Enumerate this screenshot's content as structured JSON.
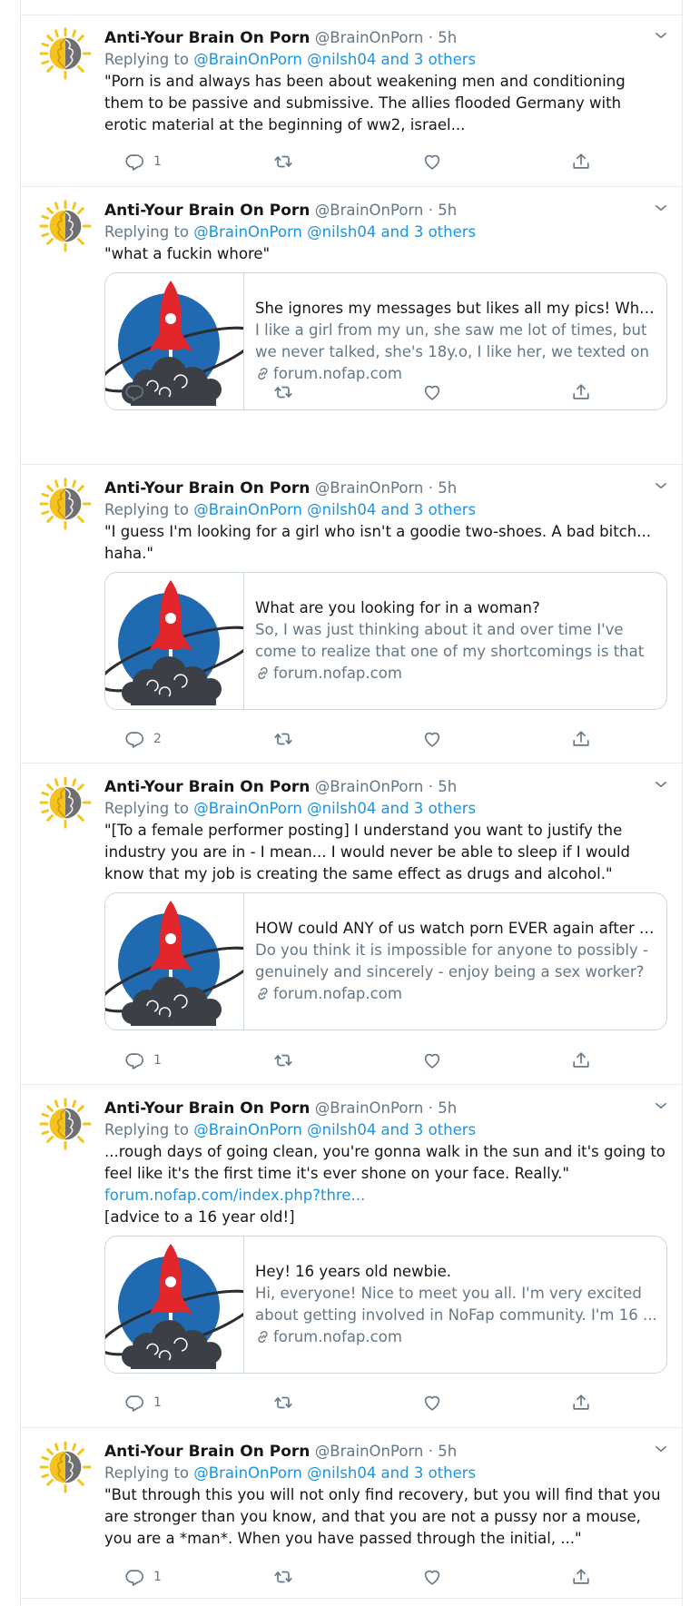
{
  "tweets": [
    {
      "name": "Anti-Your Brain On Porn",
      "handle": "@BrainOnPorn",
      "time": "· 5h",
      "replying_prefix": "Replying to ",
      "replying_to": "@BrainOnPorn @nilsh04 and 3 others",
      "text": "\"Porn is and always has been about weakening men and conditioning them to be passive and submissive. The allies flooded Germany with erotic material at the beginning of ww2, israel...",
      "reply_count": "1"
    },
    {
      "name": "Anti-Your Brain On Porn",
      "handle": "@BrainOnPorn",
      "time": "· 5h",
      "replying_prefix": "Replying to ",
      "replying_to": "@BrainOnPorn @nilsh04 and 3 others",
      "text": "\"what a fuckin whore\"",
      "card": {
        "title": "She ignores my messages but likes all my pics! What ...",
        "description": "I like a girl from my un, she saw me lot of times, but we never talked, she's 18y.o, I like her, we texted on ...",
        "domain": "forum.nofap.com"
      },
      "reply_count": ""
    },
    {
      "name": "Anti-Your Brain On Porn",
      "handle": "@BrainOnPorn",
      "time": "· 5h",
      "replying_prefix": "Replying to ",
      "replying_to": "@BrainOnPorn @nilsh04 and 3 others",
      "text": "\"I guess I'm looking for a girl who isn't a goodie two-shoes. A bad bitch... haha.\"",
      "card": {
        "title": "What are you looking for in a woman?",
        "description": "So, I was just thinking about it and over time I've come to realize that one of my shortcomings is that my vie...",
        "domain": "forum.nofap.com"
      },
      "reply_count": "2"
    },
    {
      "name": "Anti-Your Brain On Porn",
      "handle": "@BrainOnPorn",
      "time": "· 5h",
      "replying_prefix": "Replying to ",
      "replying_to": "@BrainOnPorn @nilsh04 and 3 others",
      "text": "\"[To a female performer posting] I understand you want to justify the industry you are in - I mean... I would never be able to sleep if I would know that my job is creating the same effect as drugs and alcohol.\"",
      "card": {
        "title": "HOW could ANY of us watch porn EVER again after s...",
        "description": "Do you think it is impossible for anyone to possibly - genuinely and sincerely - enjoy being a sex worker? ...",
        "domain": "forum.nofap.com"
      },
      "reply_count": "1"
    },
    {
      "name": "Anti-Your Brain On Porn",
      "handle": "@BrainOnPorn",
      "time": "· 5h",
      "replying_prefix": "Replying to ",
      "replying_to": "@BrainOnPorn @nilsh04 and 3 others",
      "text": "...rough days of going clean, you're gonna walk in the sun and it's going to feel like it's the first time it's ever shone on your face. Really.\"",
      "text_link": "forum.nofap.com/index.php?thre...",
      "text_extra": "[advice to a 16 year old!]",
      "card": {
        "title": "Hey! 16 years old newbie.",
        "description": "Hi, everyone! Nice to meet you all. I'm very excited about getting involved in NoFap community. I'm 16 ...",
        "domain": "forum.nofap.com"
      },
      "reply_count": "1"
    },
    {
      "name": "Anti-Your Brain On Porn",
      "handle": "@BrainOnPorn",
      "time": "· 5h",
      "replying_prefix": "Replying to ",
      "replying_to": "@BrainOnPorn @nilsh04 and 3 others",
      "text": "\"But through this you will not only find recovery, but you will find that you are stronger than you know, and that you are not a pussy nor a mouse, you are a *man*. When you have passed through the initial, ...\"",
      "reply_count": "1"
    }
  ],
  "colors": {
    "link": "#1b95e0",
    "secondary_text": "#657786",
    "border": "#e6ecf0",
    "card_border": "#ccd6dd",
    "logo_blue": "#1f6ab1",
    "logo_red": "#e3262b",
    "logo_cloud": "#3c3f45",
    "brain_yellow": "#f6c21c"
  },
  "icons": [
    "avatar-brain-sun",
    "chevron-down-icon",
    "reply-icon",
    "retweet-icon",
    "like-icon",
    "share-icon",
    "link-icon",
    "nofap-rocket-logo"
  ]
}
